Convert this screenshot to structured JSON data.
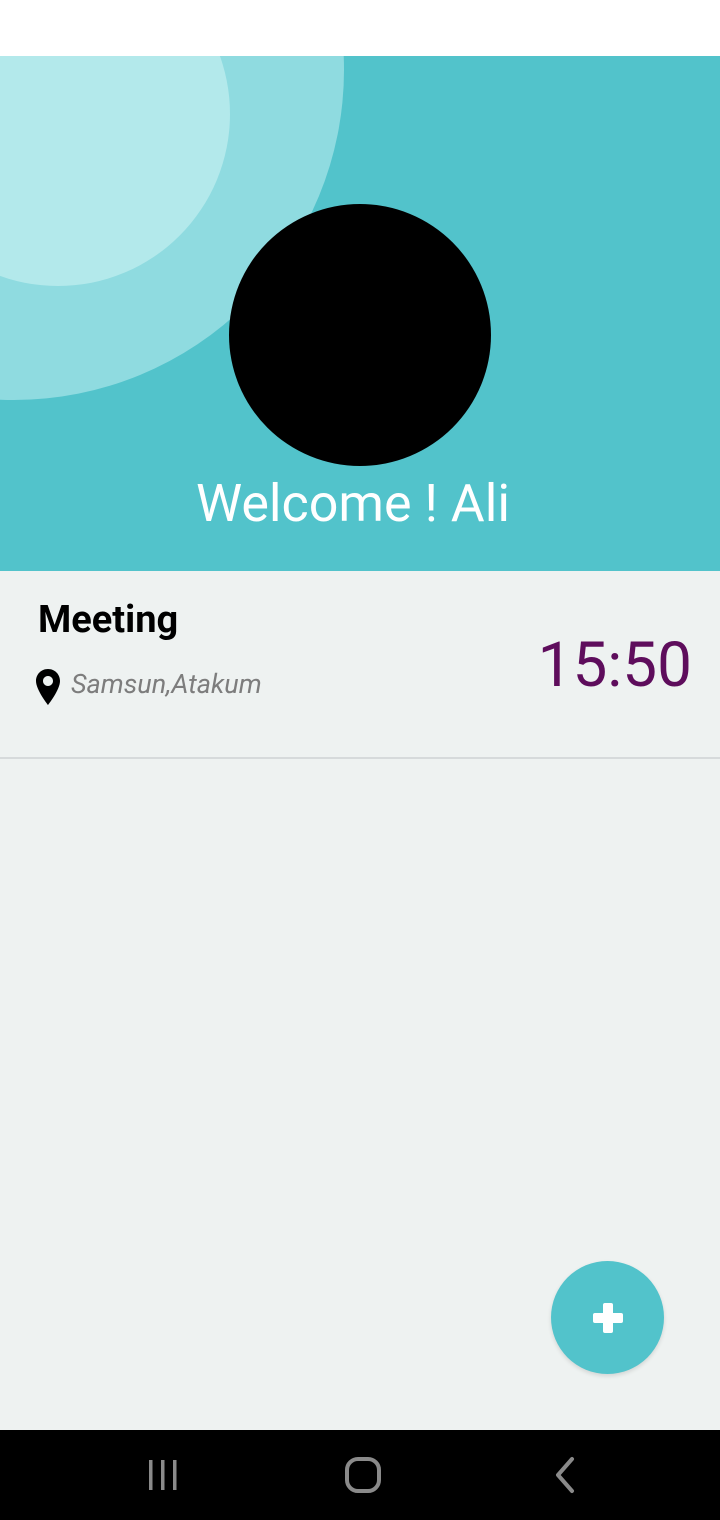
{
  "header": {
    "welcome_text": "Welcome ! Ali",
    "background_color": "#52c3cb",
    "avatar_icon": "avatar-placeholder"
  },
  "events": [
    {
      "title": "Meeting",
      "location": "Samsun,Atakum",
      "time": "15:50",
      "location_icon": "map-pin-icon"
    }
  ],
  "fab": {
    "icon": "plus-icon",
    "color": "#52c3cb"
  },
  "nav_bar": {
    "recents_icon": "recents-icon",
    "home_icon": "home-icon",
    "back_icon": "back-icon"
  },
  "colors": {
    "accent": "#52c3cb",
    "time_color": "#5e0d5c",
    "content_background": "#eef2f1"
  }
}
